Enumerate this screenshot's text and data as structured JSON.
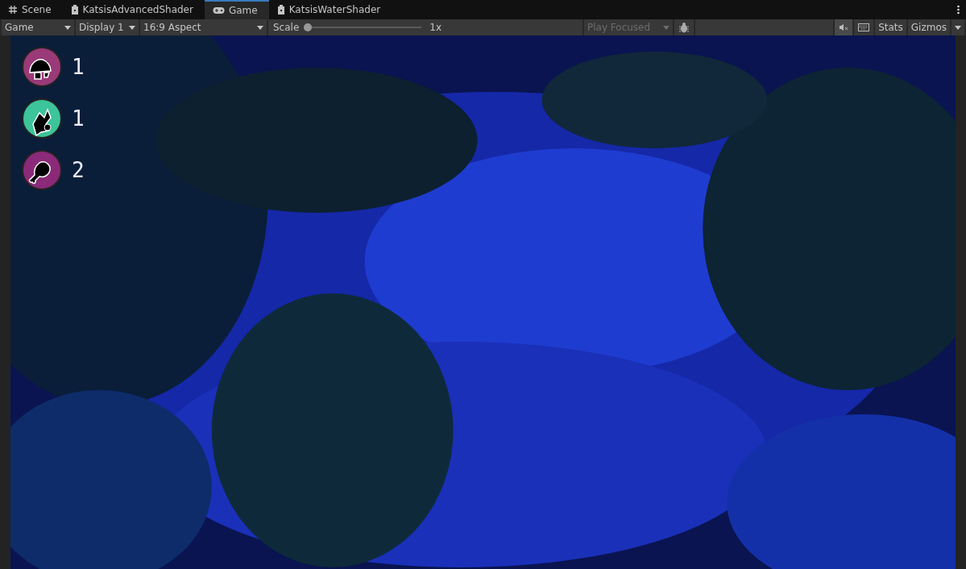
{
  "tabs": [
    {
      "label": "Scene",
      "kind": "grid",
      "selected": false
    },
    {
      "label": "KatsisAdvancedShader",
      "kind": "shader",
      "selected": false
    },
    {
      "label": "Game",
      "kind": "gamepad",
      "selected": true
    },
    {
      "label": "KatsisWaterShader",
      "kind": "shader",
      "selected": false
    }
  ],
  "toolbar": {
    "view_dropdown": "Game",
    "display_dropdown": "Display 1",
    "aspect_dropdown": "16:9 Aspect",
    "scale_label": "Scale",
    "scale": {
      "level": 0,
      "reading": "1x"
    },
    "play_mode_dropdown": {
      "label": "Play Focused",
      "disabled": true
    },
    "mute_audio": {
      "on": true
    },
    "stats_button": "Stats",
    "gizmos_button": "Gizmos"
  },
  "game_view": {
    "kind": "picture",
    "hud": [
      {
        "kind": "mushroom",
        "color": "#9a3a78",
        "count": "1"
      },
      {
        "kind": "leaf",
        "color": "#3cc49a",
        "count": "1"
      },
      {
        "kind": "drumstick",
        "color": "#8a2a78",
        "count": "2"
      }
    ]
  }
}
